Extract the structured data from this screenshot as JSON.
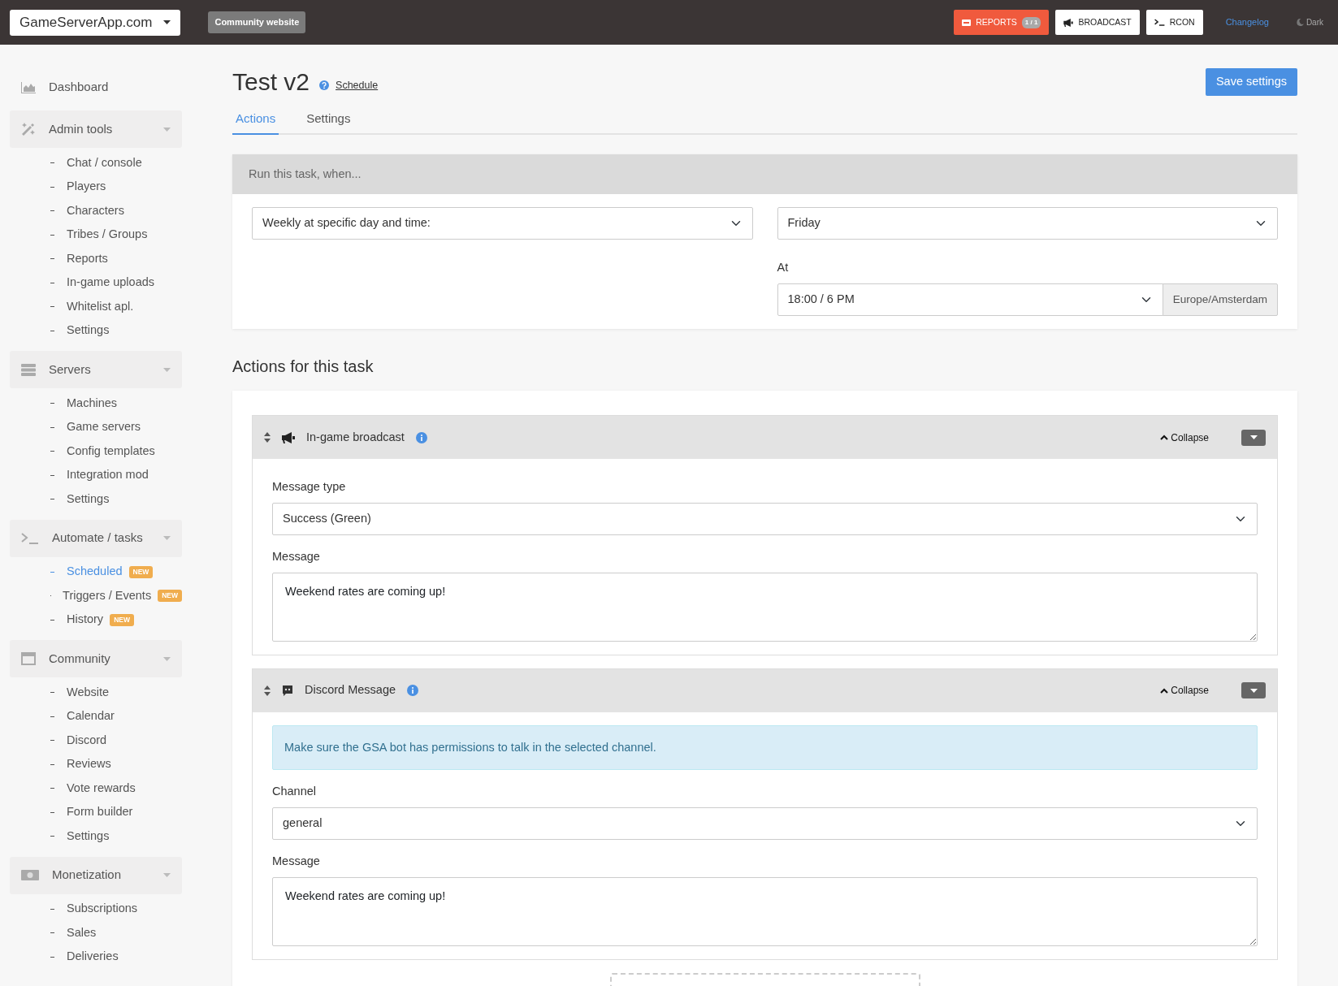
{
  "topbar": {
    "brand": "GameServerApp.com",
    "community_button": "Community website",
    "reports": {
      "label": "REPORTS",
      "count": "1 / 1"
    },
    "broadcast": "BROADCAST",
    "rcon": "RCON",
    "changelog": "Changelog",
    "theme": "Dark"
  },
  "sidebar": [
    {
      "label": "Dashboard"
    },
    {
      "label": "Admin tools",
      "children": [
        {
          "label": "Chat / console",
          "selected": false
        },
        {
          "label": "Players",
          "selected": false
        },
        {
          "label": "Characters",
          "selected": false
        },
        {
          "label": "Tribes / Groups",
          "selected": false
        },
        {
          "label": "Reports",
          "selected": false
        },
        {
          "label": "In-game uploads",
          "selected": false
        },
        {
          "label": "Whitelist apl.",
          "selected": false
        },
        {
          "label": "Settings",
          "selected": false
        }
      ]
    },
    {
      "label": "Servers",
      "children": [
        {
          "label": "Machines",
          "selected": false
        },
        {
          "label": "Game servers",
          "selected": false
        },
        {
          "label": "Config templates",
          "selected": false
        },
        {
          "label": "Integration mod",
          "selected": false
        },
        {
          "label": "Settings",
          "selected": false
        }
      ]
    },
    {
      "label": "Automate / tasks",
      "children": [
        {
          "label": "Scheduled",
          "selected": true,
          "badge": "NEW"
        },
        {
          "label": "Triggers / Events",
          "selected": false,
          "badge": "NEW"
        },
        {
          "label": "History",
          "selected": false,
          "badge": "NEW"
        }
      ]
    },
    {
      "label": "Community",
      "children": [
        {
          "label": "Website",
          "selected": false
        },
        {
          "label": "Calendar",
          "selected": false
        },
        {
          "label": "Discord",
          "selected": false
        },
        {
          "label": "Reviews",
          "selected": false
        },
        {
          "label": "Vote rewards",
          "selected": false
        },
        {
          "label": "Form builder",
          "selected": false
        },
        {
          "label": "Settings",
          "selected": false
        }
      ]
    },
    {
      "label": "Monetization",
      "children": [
        {
          "label": "Subscriptions",
          "selected": false
        },
        {
          "label": "Sales",
          "selected": false
        },
        {
          "label": "Deliveries",
          "selected": false
        }
      ]
    }
  ],
  "page": {
    "title": "Test v2",
    "type_link": "Schedule",
    "save_button": "Save settings",
    "tabs": [
      {
        "label": "Actions",
        "selected": true
      },
      {
        "label": "Settings",
        "selected": false
      }
    ],
    "trigger": {
      "heading": "Run this task, when...",
      "frequency": "Weekly at specific day and time:",
      "day": "Friday",
      "at_label": "At",
      "time": "18:00 / 6 PM",
      "timezone": "Europe/Amsterdam"
    },
    "actions_heading": "Actions for this task",
    "actions": [
      {
        "kind": "broadcast",
        "title": "In-game broadcast",
        "collapse": "Collapse",
        "fields": [
          {
            "kind": "select",
            "label": "Message type",
            "value": "Success (Green)"
          },
          {
            "kind": "textarea",
            "label": "Message",
            "value": "Weekend rates are coming up!"
          }
        ]
      },
      {
        "kind": "discord",
        "title": "Discord Message",
        "collapse": "Collapse",
        "alert": "Make sure the GSA bot has permissions to talk in the selected channel.",
        "fields": [
          {
            "kind": "select",
            "label": "Channel",
            "value": "general"
          },
          {
            "kind": "textarea",
            "label": "Message",
            "value": "Weekend rates are coming up!"
          }
        ]
      }
    ]
  }
}
